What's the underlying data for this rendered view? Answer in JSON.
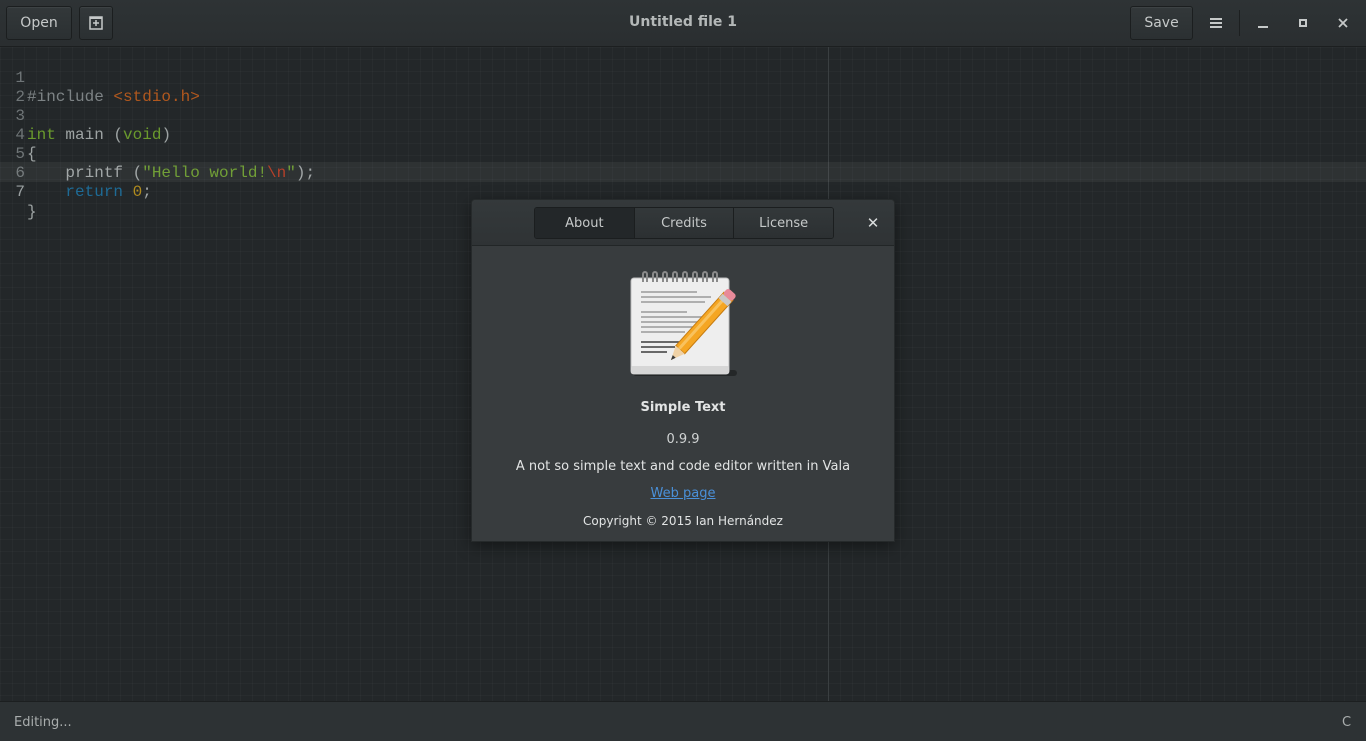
{
  "header": {
    "open_label": "Open",
    "title": "Untitled file 1",
    "save_label": "Save"
  },
  "icons": {
    "new_tab": "new-tab-icon",
    "menu": "hamburger-menu-icon",
    "minimize": "minimize-icon",
    "maximize": "maximize-icon",
    "close": "close-icon",
    "app_logo": "notepad-pencil-icon"
  },
  "editor": {
    "line_numbers": [
      "1",
      "2",
      "3",
      "4",
      "5",
      "6",
      "7"
    ],
    "current_line": "7",
    "tokens": {
      "l1_pre": "#include ",
      "l1_inc": "<stdio.h>",
      "l3_int": "int",
      "l3_main": " main (",
      "l3_void": "void",
      "l3_close": ")",
      "l4_brace": "{",
      "l5_indent": "    ",
      "l5_call": "printf (",
      "l5_str1": "\"Hello world!",
      "l5_esc": "\\n",
      "l5_str2": "\"",
      "l5_end": ");",
      "l6_indent": "    ",
      "l6_kw": "return",
      "l6_sp": " ",
      "l6_num": "0",
      "l6_end": ";",
      "l7_brace": "}"
    }
  },
  "statusbar": {
    "text": "Editing...",
    "right": "C"
  },
  "about_dialog": {
    "tabs": [
      "About",
      "Credits",
      "License"
    ],
    "active_tab": "About",
    "close_glyph": "✕",
    "app_name": "Simple Text",
    "version": "0.9.9",
    "description": "A not so simple text and code editor written in Vala",
    "link_text": "Web page",
    "copyright": "Copyright © 2015 Ian Hernández"
  },
  "colors": {
    "background": "#232729",
    "header": "#2e3335",
    "dialog": "#383c3e",
    "link": "#4a90d9",
    "keyword_green": "#6a9a2d",
    "keyword_blue": "#1e6b96",
    "include_orange": "#b1581e",
    "number_yellow": "#b18c1e",
    "escape_red": "#b1361e"
  }
}
